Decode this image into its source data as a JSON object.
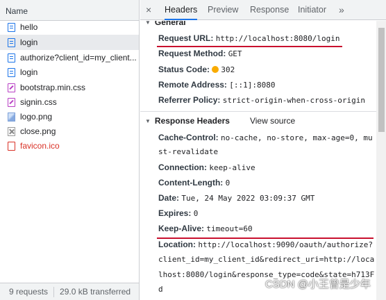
{
  "left_panel": {
    "header": "Name",
    "files": [
      {
        "name": "hello",
        "icon": "document-icon",
        "selected": false,
        "error": false
      },
      {
        "name": "login",
        "icon": "document-icon",
        "selected": true,
        "error": false
      },
      {
        "name": "authorize?client_id=my_client...",
        "icon": "document-icon",
        "selected": false,
        "error": false
      },
      {
        "name": "login",
        "icon": "document-icon",
        "selected": false,
        "error": false
      },
      {
        "name": "bootstrap.min.css",
        "icon": "stylesheet-icon",
        "selected": false,
        "error": false
      },
      {
        "name": "signin.css",
        "icon": "stylesheet-icon",
        "selected": false,
        "error": false
      },
      {
        "name": "logo.png",
        "icon": "image-icon",
        "selected": false,
        "error": false
      },
      {
        "name": "close.png",
        "icon": "broken-image-icon",
        "selected": false,
        "error": false
      },
      {
        "name": "favicon.ico",
        "icon": "error-file-icon",
        "selected": false,
        "error": true
      }
    ],
    "footer": {
      "requests": "9 requests",
      "transferred": "29.0 kB transferred"
    }
  },
  "tabs": {
    "close": "×",
    "items": [
      "Headers",
      "Preview",
      "Response",
      "Initiator"
    ],
    "active": "Headers",
    "more": "»"
  },
  "general": {
    "title": "General",
    "request_url": {
      "key": "Request URL:",
      "value": "http://localhost:8080/login"
    },
    "request_method": {
      "key": "Request Method:",
      "value": "GET"
    },
    "status_code": {
      "key": "Status Code:",
      "value": "302"
    },
    "remote_address": {
      "key": "Remote Address:",
      "value": "[::1]:8080"
    },
    "referrer_policy": {
      "key": "Referrer Policy:",
      "value": "strict-origin-when-cross-origin"
    }
  },
  "response_headers": {
    "title": "Response Headers",
    "view_source": "View source",
    "cache_control": {
      "key": "Cache-Control:",
      "value": "no-cache, no-store, max-age=0, mu",
      "value_cont": "st-revalidate"
    },
    "connection": {
      "key": "Connection:",
      "value": "keep-alive"
    },
    "content_length": {
      "key": "Content-Length:",
      "value": "0"
    },
    "date": {
      "key": "Date:",
      "value": "Tue, 24 May 2022 03:09:37 GMT"
    },
    "expires": {
      "key": "Expires:",
      "value": "0"
    },
    "keep_alive": {
      "key": "Keep-Alive:",
      "value": "timeout=60"
    },
    "location": {
      "key": "Location:",
      "value": "http://localhost:9090/oauth/authorize?",
      "cont1": "client_id=my_client_id&redirect_uri=http://loca",
      "cont2": "lhost:8080/login&response_type=code&state=h713F",
      "cont3": "d"
    }
  },
  "watermark": "CSDN @小王曾是少年",
  "colors": {
    "accent": "#1a73e8",
    "annotation": "#c8102e",
    "status_dot": "#f9ab00",
    "error": "#d93025"
  }
}
